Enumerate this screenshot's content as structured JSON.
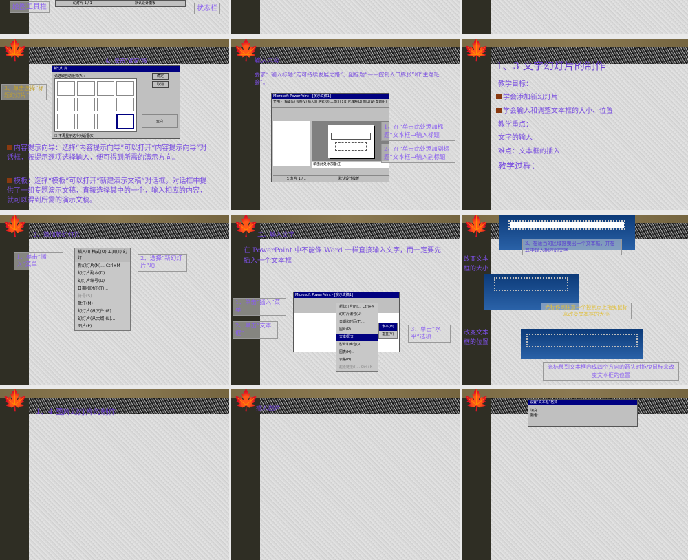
{
  "slides_row0": {
    "s1": {
      "drawing_toolbar_label": "绘图工具栏",
      "status_bar_label": "状态栏",
      "status_page": "幻灯片 1 / 1",
      "status_template": "默认设计模板"
    }
  },
  "slide_new_layout": {
    "callout_ok": "4、单击“确定”按钮",
    "callout_select": "3、单击选择“标题幻灯片”",
    "dialog_title": "新幻灯片",
    "dialog_prompt": "请选取自动版式(A):",
    "ok": "确定",
    "cancel": "取消",
    "blank": "空白",
    "dont_show": "不再显示这个对话框(S)",
    "para1": "内容提示向导：选择“内容提示向导”可以打开“内容提示向导”对话框，按提示逐项选择输入，便可得到所需的演示方向。",
    "para2": "模板：选择“模板”可以打开”新建演示文稿“对话框，对话框中提供了一组专题演示文稿，直接选择其中的一个，输入相应的内容，就可以得到所需的演示文稿。"
  },
  "slide_input": {
    "title": "输入内容",
    "req": "要求：输入标题”走可持续发展之路”、副标题“——控制人口膨胀”和“主题班会”。",
    "app_title": "Microsoft PowerPoint - [演示文稿1]",
    "menu": "文件(F) 编辑(E) 视图(V) 插入(I) 格式(O) 工具(T) 幻灯片放映(D) 窗口(W) 帮助(H)",
    "notes": "单击此处添加备注",
    "status_page": "幻灯片 1 / 1",
    "status_template": "默认设计模板",
    "callout1": "1、在“单击此处添加标题”文本框中输入标题",
    "callout2": "2、在“单击此处添加副标题”文本框中输入副标题"
  },
  "slide_objectives": {
    "title": "1、3 文字幻灯片的制作",
    "goal_label": "教学目标：",
    "goal1": "学会添加新幻灯片",
    "goal2": "学会输入和调整文本框的大小、位置",
    "key_label": "教学重点：",
    "key": "文字的输入",
    "difficulty": "难点：文本框的插入",
    "process": "教学过程："
  },
  "slide_add": {
    "title": "2、添加新幻灯片",
    "menu_bar": "插入(I) 格式(O) 工具(T) 幻灯",
    "items": [
      "新幻灯片(N)... Ctrl+M",
      "幻灯片副本(D)",
      "幻灯片编号(U)",
      "日期和时间(T)...",
      "符号(S)...",
      "批注(M)",
      "幻灯片(从文件)(F)...",
      "幻灯片(从大纲)(L)...",
      "图片(P)"
    ],
    "callout1": "1、单击”插入”菜单",
    "callout2": "2、选择”新幻灯片”项"
  },
  "slide_text": {
    "title": "二、输入文字",
    "para": "在 PowerPoint 中不能像 Word 一样直接输入文字，而一定要先插入一个文本框",
    "app_title": "Microsoft PowerPoint - [演示文稿1]",
    "items": [
      "新幻灯片(N)... Ctrl+M",
      "幻灯片编号(U)",
      "日期和时间(T)...",
      "图片(P)",
      "文本框(X)",
      "影片和声音(V)",
      "图表(H)...",
      "表格(B)...",
      "超级链接(I)... Ctrl+K"
    ],
    "sub": [
      "水平(H)",
      "垂直(V)"
    ],
    "callout1": "1、单击”插入”菜单",
    "callout2": "2、单击”文本框”",
    "callout3": "3、单击”水平”选项"
  },
  "slide_resize": {
    "callout_top": "3、在适当的区域拖曳出一个文本框，并在其中输入相应的文字",
    "label_size": "改变文本框的大小",
    "callout_size": "光标移到任意一个控制点上拖曳鼠标来改变文本框的大小",
    "label_pos": "改变文本框的位置",
    "callout_pos": "光标移到文本框内成四个方向的箭头时拖曳鼠标来改变文本框的位置"
  },
  "slides_row3": {
    "s1_title": "1、4 图片幻灯片的制作",
    "s2_title": "插入图片",
    "s3_dialog": "设置“文本框”格式",
    "s3_fill": "填充",
    "s3_color": "颜色:"
  }
}
